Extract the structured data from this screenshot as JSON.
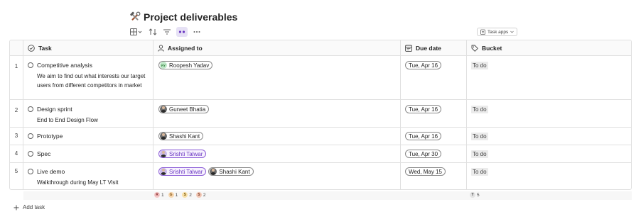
{
  "page": {
    "title": "Project deliverables",
    "title_icon": "hammer-wrench-icon"
  },
  "toolbar": {
    "items": [
      "grid-view-icon",
      "sort-icon",
      "filter-icon",
      "group-icon",
      "more-icon"
    ],
    "task_apps_label": "Task apps"
  },
  "columns": {
    "task": "Task",
    "assigned": "Assigned to",
    "due": "Due date",
    "bucket": "Bucket"
  },
  "rows": [
    {
      "num": "1",
      "task": "Competitive analysis",
      "desc": "We aim to find out what interests our target users from different competitors in market",
      "assignees": [
        {
          "name": "Roopesh Yadav",
          "initials": "RY",
          "style": "initials"
        }
      ],
      "due": "Tue, Apr 16",
      "bucket": "To do"
    },
    {
      "num": "2",
      "task": "Design sprint",
      "desc": "End to End Design Flow",
      "assignees": [
        {
          "name": "Guneet Bhatia",
          "style": "photo"
        }
      ],
      "due": "Tue, Apr 16",
      "bucket": "To do"
    },
    {
      "num": "3",
      "task": "Prototype",
      "desc": "",
      "assignees": [
        {
          "name": "Shashi Kant",
          "style": "photo"
        }
      ],
      "due": "Tue, Apr 16",
      "bucket": "To do"
    },
    {
      "num": "4",
      "task": "Spec",
      "desc": "",
      "assignees": [
        {
          "name": "Srishti Talwar",
          "style": "photo-purple"
        }
      ],
      "due": "Tue, Apr 30",
      "bucket": "To do"
    },
    {
      "num": "5",
      "task": "Live demo",
      "desc": "Walkthrough during May LT Visit",
      "assignees": [
        {
          "name": "Srishti Talwar",
          "style": "photo-purple"
        },
        {
          "name": "Shashi Kant",
          "style": "photo"
        }
      ],
      "due": "Wed, May 15",
      "bucket": "To do"
    }
  ],
  "summary": {
    "assignees": [
      {
        "letter": "R",
        "count": "1",
        "color": "#f4c7c7"
      },
      {
        "letter": "G",
        "count": "1",
        "color": "#f6d7b0"
      },
      {
        "letter": "S",
        "count": "2",
        "color": "#f8e0a8"
      },
      {
        "letter": "S",
        "count": "2",
        "color": "#f2c9b8"
      }
    ],
    "bucket": {
      "letter": "T",
      "count": "5"
    }
  },
  "footer": {
    "add_task": "Add task"
  },
  "colors": {
    "accent": "#6b38c2",
    "border": "#e0e0e0"
  }
}
